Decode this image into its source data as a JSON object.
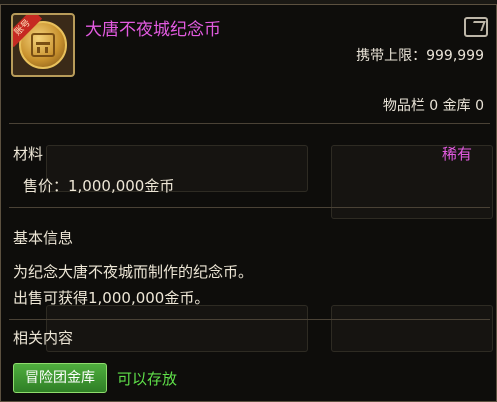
{
  "item": {
    "badge_text": "账号",
    "title": "大唐不夜城纪念币",
    "carry_limit": "携带上限：999,999",
    "inventory": "物品栏 0 金库 0"
  },
  "material": {
    "section_title": "材料",
    "rarity": "稀有",
    "price": "售价：1,000,000金币"
  },
  "basic_info": {
    "section_title": "基本信息",
    "line1": "为纪念大唐不夜城而制作的纪念币。",
    "line2": "出售可获得1,000,000金币。"
  },
  "related": {
    "section_title": "相关内容",
    "button_label": "冒险团金库",
    "status": "可以存放"
  },
  "colors": {
    "title_purple": "#e25be0",
    "rarity_purple": "#e25be0",
    "green_text": "#5fe04a",
    "button_green": "#3f9a33",
    "border_gold": "#b89c5a"
  },
  "icons": {
    "item_icon": "coin-icon",
    "share_icon": "share-icon"
  }
}
